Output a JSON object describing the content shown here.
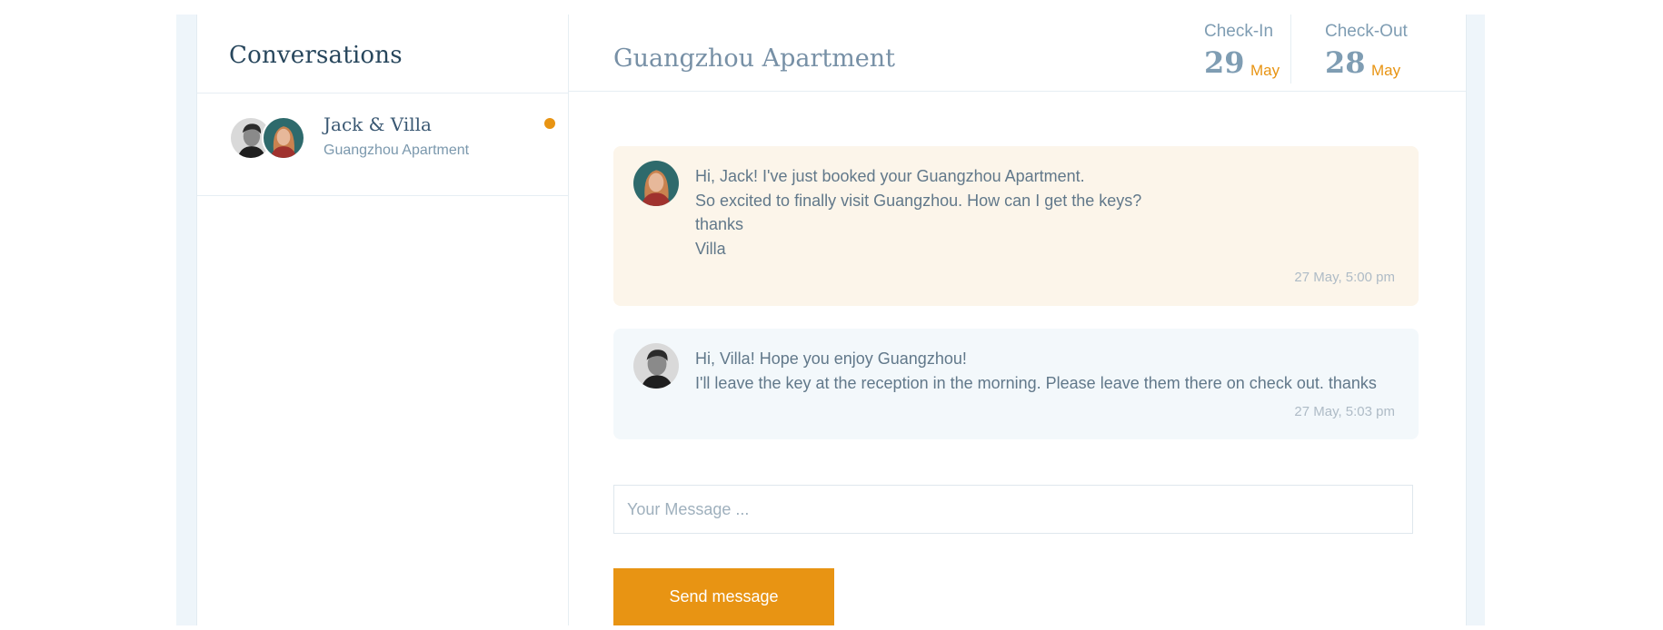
{
  "sidebar": {
    "title": "Conversations",
    "conversations": [
      {
        "name": "Jack & Villa",
        "subtitle": "Guangzhou Apartment",
        "unread": true
      }
    ]
  },
  "main": {
    "title": "Guangzhou Apartment",
    "check_in": {
      "label": "Check-In",
      "day": "29",
      "month": "May"
    },
    "check_out": {
      "label": "Check-Out",
      "day": "28",
      "month": "May"
    },
    "messages": [
      {
        "sender": "Villa",
        "lines": [
          "Hi, Jack! I've just booked your Guangzhou Apartment.",
          "So excited to finally visit Guangzhou. How can I get the keys?",
          "thanks",
          "Villa"
        ],
        "time": "27 May, 5:00 pm"
      },
      {
        "sender": "Jack",
        "lines": [
          "Hi, Villa! Hope you enjoy Guangzhou!",
          "I'll leave the key at the reception in the morning. Please leave them there on check out. thanks"
        ],
        "time": "27 May, 5:03 pm"
      }
    ],
    "input_placeholder": "Your Message ...",
    "send_label": "Send message"
  },
  "colors": {
    "accent": "#e89413",
    "incoming_bg": "#fcf5ea",
    "outgoing_bg": "#f3f8fb",
    "title": "#27465c"
  }
}
